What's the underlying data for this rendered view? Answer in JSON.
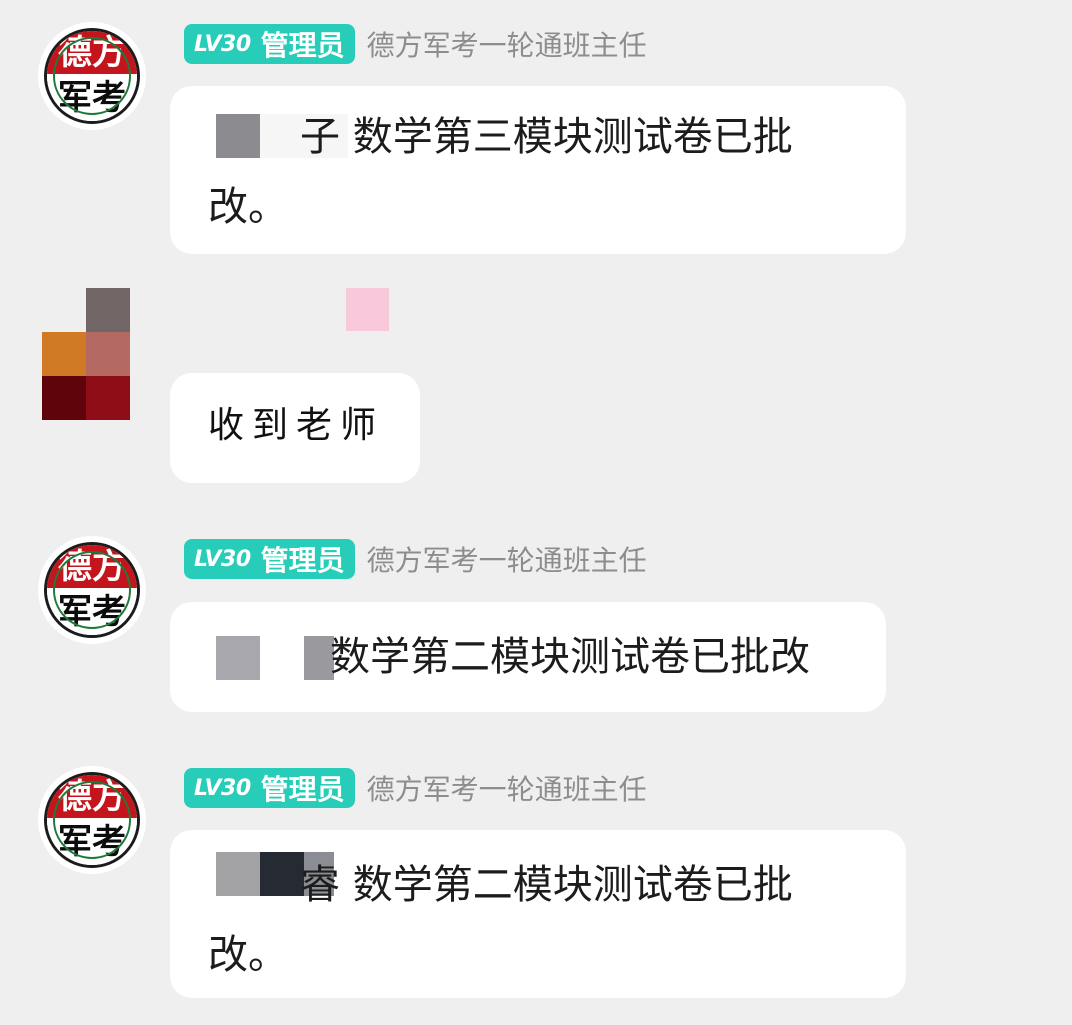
{
  "messages": [
    {
      "sender": {
        "avatar_text": [
          "德",
          "方",
          "军",
          "考"
        ],
        "level": "LV30",
        "role": "管理员",
        "title": "德方军考一轮通班主任"
      },
      "text_line1": "子 数学第三模块测试卷已批",
      "text_line2": "改。"
    },
    {
      "sender": {
        "name_hidden": true
      },
      "text": "收到老师"
    },
    {
      "sender": {
        "avatar_text": [
          "德",
          "方",
          "军",
          "考"
        ],
        "level": "LV30",
        "role": "管理员",
        "title": "德方军考一轮通班主任"
      },
      "text_line1": "数学第二模块测试卷已批改"
    },
    {
      "sender": {
        "avatar_text": [
          "德",
          "方",
          "军",
          "考"
        ],
        "level": "LV30",
        "role": "管理员",
        "title": "德方军考一轮通班主任"
      },
      "text_line1": "睿 数学第二模块测试卷已批",
      "text_line2": "改。"
    }
  ],
  "colors": {
    "background": "#efefef",
    "bubble": "#ffffff",
    "badge": "#27cdb9",
    "title_text": "#8d8d8d",
    "logo_red": "#c4151c"
  }
}
